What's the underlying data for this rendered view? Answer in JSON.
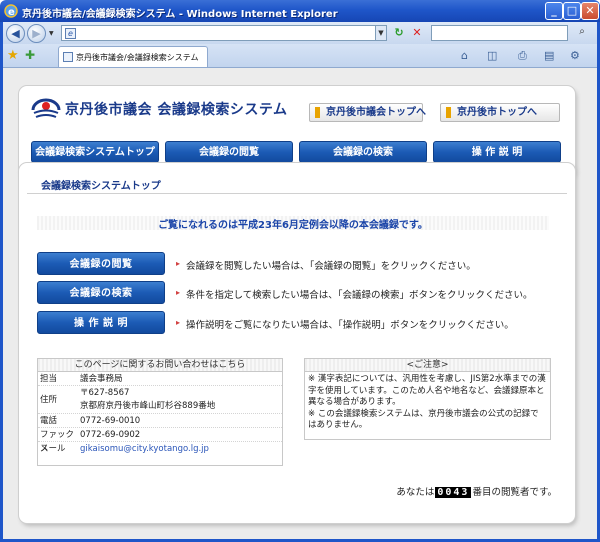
{
  "window": {
    "title": "京丹後市議会/会議録検索システム - Windows Internet Explorer",
    "minimize_glyph": "_",
    "maximize_glyph": "□",
    "close_glyph": "✕"
  },
  "browser": {
    "address_value": "",
    "search_value": "",
    "tab_label": "京丹後市議会/会議録検索システム",
    "icons": [
      "back-icon",
      "forward-icon",
      "refresh-icon",
      "stop-icon",
      "search-icon",
      "favorites-star-icon",
      "add-favorites-icon",
      "home-icon",
      "feeds-icon",
      "print-icon",
      "page-icon",
      "tools-icon"
    ]
  },
  "header": {
    "site_title": "京丹後市議会 会議録検索システム",
    "top_links": [
      "京丹後市議会トップへ",
      "京丹後市トップへ"
    ],
    "nav": [
      "会議録検索システムトップ",
      "会議録の閲覧",
      "会議録の検索",
      "操 作 説 明"
    ]
  },
  "main": {
    "section_title": "会議録検索システムトップ",
    "notice": "ご覧になれるのは平成23年6月定例会以降の本会議録です。",
    "actions": [
      {
        "button": "会議録の閲覧",
        "description": "会議録を閲覧したい場合は、「会議録の閲覧」をクリックください。"
      },
      {
        "button": "会議録の検索",
        "description": "条件を指定して検索したい場合は、「会議録の検索」ボタンをクリックください。"
      },
      {
        "button": "操 作 説 明",
        "description": "操作説明をご覧になりたい場合は、「操作説明」ボタンをクリックください。"
      }
    ],
    "arrow_glyph": "▸"
  },
  "contact": {
    "heading": "このページに関するお問い合わせはこちら",
    "rows": {
      "dept_label": "担当",
      "dept_value": "議会事務局",
      "address_label": "住所",
      "postal": "〒627-8567",
      "address": "京都府京丹後市峰山町杉谷889番地",
      "phone_label": "電話",
      "phone_value": "0772-69-0010",
      "fax_label": "ファックス",
      "fax_value": "0772-69-0902",
      "email_label": "メール",
      "email_value": "gikaisomu@city.kyotango.lg.jp"
    }
  },
  "caution": {
    "heading": "<ご注意>",
    "line1": "※ 漢字表記については、汎用性を考慮し、JIS第2水準までの漢字を使用しています。このため人名や地名など、会議録原本と異なる場合があります。",
    "line2": "※ この会議録検索システムは、京丹後市議会の公式の記録ではありません。"
  },
  "counter": {
    "prefix": "あなたは",
    "digits": "0043",
    "suffix": "番目の閲覧者です。"
  },
  "colors": {
    "titlebar": "#1f56c9",
    "nav_button": "#1c5bb5",
    "title_text": "#1a3a8a",
    "notice_text": "#1a44a8",
    "link_accent": "#e8a300",
    "arrow": "#d24040"
  }
}
